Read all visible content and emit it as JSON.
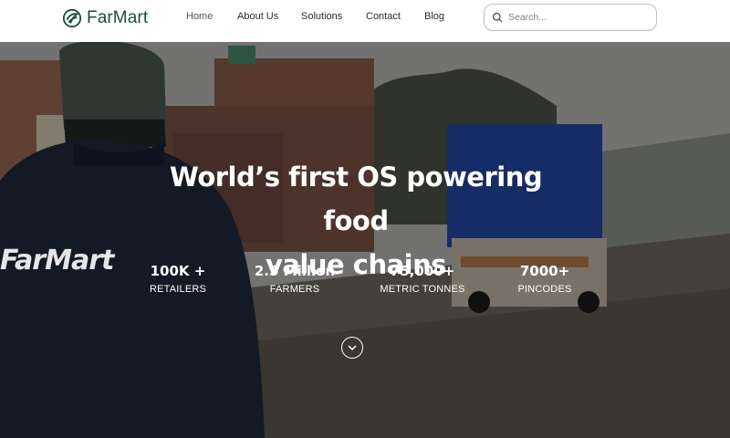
{
  "brand": {
    "name": "FarMart",
    "color": "#1e4d3a"
  },
  "nav": [
    {
      "label": "Home",
      "active": true
    },
    {
      "label": "About Us"
    },
    {
      "label": "Solutions"
    },
    {
      "label": "Contact"
    },
    {
      "label": "Blog"
    }
  ],
  "search": {
    "placeholder": "Search...",
    "value": "",
    "icon": "search-icon"
  },
  "hero": {
    "title_line1": "World’s first OS powering food",
    "title_line2": "value chains",
    "jacket_text": "FarMart",
    "stats": [
      {
        "value": "100K +",
        "label": "RETAILERS"
      },
      {
        "value": "2.5 Million",
        "label": "FARMERS"
      },
      {
        "value": "75,000+",
        "label": "METRIC TONNES"
      },
      {
        "value": "7000+",
        "label": "PINCODES"
      }
    ],
    "scroll_icon": "chevron-down-icon"
  }
}
